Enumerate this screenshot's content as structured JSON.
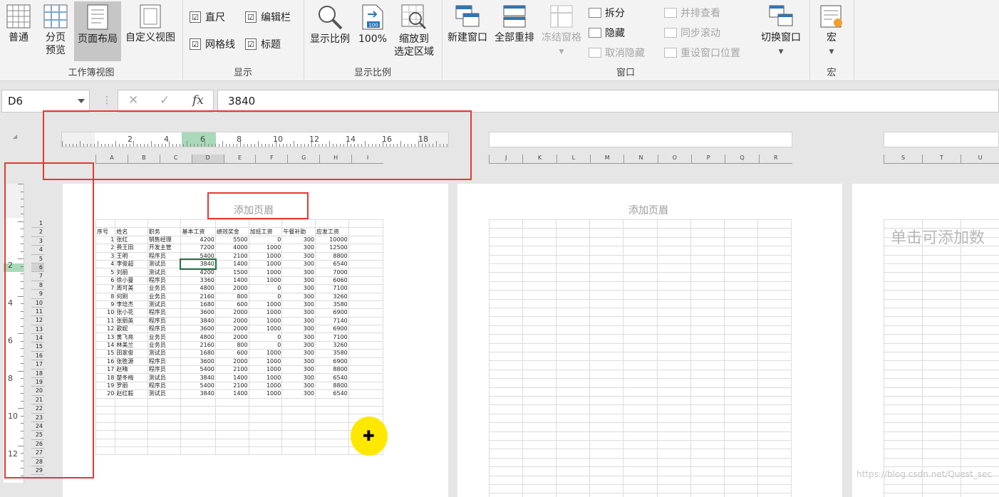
{
  "ribbon": {
    "workbook_views": {
      "group_label": "工作簿视图",
      "normal": "普通",
      "page_break_1": "分页",
      "page_break_2": "预览",
      "page_layout": "页面布局",
      "custom_views": "自定义视图"
    },
    "show": {
      "group_label": "显示",
      "ruler": "直尺",
      "formula_bar": "编辑栏",
      "gridlines": "网格线",
      "headings": "标题",
      "check_mark": "☑"
    },
    "zoom": {
      "group_label": "显示比例",
      "zoom": "显示比例",
      "hundred": "100%",
      "zoom_sel_1": "缩放到",
      "zoom_sel_2": "选定区域",
      "icon_text": "100"
    },
    "window": {
      "group_label": "窗口",
      "new_window": "新建窗口",
      "arrange_all": "全部重排",
      "freeze": "冻结窗格",
      "split": "拆分",
      "hide": "隐藏",
      "unhide": "取消隐藏",
      "side_by_side": "并排查看",
      "sync_scroll": "同步滚动",
      "reset_pos": "重设窗口位置",
      "switch": "切换窗口"
    },
    "macro": {
      "group_label": "宏",
      "macros": "宏"
    }
  },
  "formula_bar": {
    "name_box": "D6",
    "cancel": "✕",
    "enter": "✓",
    "fx": "fx",
    "value": "3840"
  },
  "ruler": {
    "labels": [
      "2",
      "4",
      "6",
      "8",
      "10",
      "12",
      "14",
      "16",
      "18"
    ],
    "v_labels": [
      "2",
      "4",
      "6",
      "8",
      "10",
      "12"
    ]
  },
  "columns": {
    "page1": [
      "A",
      "B",
      "C",
      "D",
      "E",
      "F",
      "G",
      "H",
      "I"
    ],
    "page2": [
      "J",
      "K",
      "L",
      "M",
      "N",
      "O",
      "P",
      "Q",
      "R"
    ],
    "page3": [
      "S",
      "T",
      "U"
    ]
  },
  "pages": {
    "header_placeholder": "添加页眉",
    "data_placeholder": "单击可添加数"
  },
  "table": {
    "headers": [
      "序号",
      "姓名",
      "职务",
      "基本工资",
      "绩效奖金",
      "加班工资",
      "午餐补助",
      "应发工资"
    ],
    "rows": [
      [
        "1",
        "张红",
        "销售经理",
        "4200",
        "5500",
        "0",
        "300",
        "10000"
      ],
      [
        "2",
        "费王田",
        "开发主管",
        "7200",
        "4000",
        "1000",
        "300",
        "12500"
      ],
      [
        "3",
        "王明",
        "程序员",
        "5400",
        "2100",
        "1000",
        "300",
        "8800"
      ],
      [
        "4",
        "李俊超",
        "测试员",
        "3840",
        "1400",
        "1000",
        "300",
        "6540"
      ],
      [
        "5",
        "刘丽",
        "测试员",
        "4200",
        "1500",
        "1000",
        "300",
        "7000"
      ],
      [
        "6",
        "徐小曼",
        "程序员",
        "3360",
        "1400",
        "1000",
        "300",
        "6060"
      ],
      [
        "7",
        "周可美",
        "业务员",
        "4800",
        "2000",
        "0",
        "300",
        "7100"
      ],
      [
        "8",
        "何刚",
        "业务员",
        "2160",
        "800",
        "0",
        "300",
        "3260"
      ],
      [
        "9",
        "李培杰",
        "测试员",
        "1680",
        "600",
        "1000",
        "300",
        "3580"
      ],
      [
        "10",
        "张小花",
        "程序员",
        "3600",
        "2000",
        "1000",
        "300",
        "6900"
      ],
      [
        "11",
        "张丽英",
        "程序员",
        "3840",
        "2000",
        "1000",
        "300",
        "7140"
      ],
      [
        "12",
        "歌妮",
        "程序员",
        "3600",
        "2000",
        "1000",
        "300",
        "6900"
      ],
      [
        "13",
        "黄飞亮",
        "业务员",
        "4800",
        "2000",
        "0",
        "300",
        "7100"
      ],
      [
        "14",
        "林美兰",
        "业务员",
        "2160",
        "800",
        "0",
        "300",
        "3260"
      ],
      [
        "15",
        "田家俊",
        "测试员",
        "1680",
        "600",
        "1000",
        "300",
        "3580"
      ],
      [
        "16",
        "张胜源",
        "程序员",
        "3600",
        "2000",
        "1000",
        "300",
        "6900"
      ],
      [
        "17",
        "赵晴",
        "程序员",
        "5400",
        "2100",
        "1000",
        "300",
        "8800"
      ],
      [
        "18",
        "楚冬梅",
        "测试员",
        "3840",
        "1400",
        "1000",
        "300",
        "6540"
      ],
      [
        "19",
        "罗丽",
        "程序员",
        "5400",
        "2100",
        "1000",
        "300",
        "8800"
      ],
      [
        "20",
        "赵红毅",
        "测试员",
        "3840",
        "1400",
        "1000",
        "300",
        "6540"
      ]
    ]
  },
  "row_numbers": [
    "1",
    "2",
    "3",
    "4",
    "5",
    "6",
    "7",
    "8",
    "9",
    "10",
    "11",
    "12",
    "13",
    "14",
    "15",
    "16",
    "17",
    "18",
    "19",
    "20",
    "21",
    "22",
    "23",
    "24",
    "25",
    "26",
    "27",
    "28",
    "29"
  ],
  "watermark": "https://blog.csdn.net/Quest_sec",
  "colors": {
    "highlight": "#e53935",
    "cursor": "#ffe800"
  }
}
